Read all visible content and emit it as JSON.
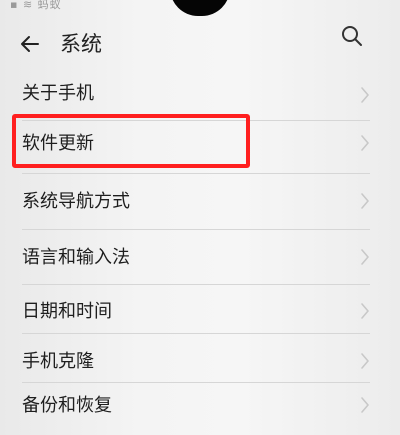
{
  "status_bar": {
    "icons_text": "▪ ≋ 蚂蚁"
  },
  "header": {
    "title": "系统",
    "back_icon": "arrow-left",
    "search_icon": "magnifier"
  },
  "menu": {
    "items": [
      {
        "label": "关于手机"
      },
      {
        "label": "软件更新"
      },
      {
        "label": "系统导航方式"
      },
      {
        "label": "语言和输入法"
      },
      {
        "label": "日期和时间"
      },
      {
        "label": "手机克隆"
      },
      {
        "label": "备份和恢复"
      }
    ]
  },
  "colors": {
    "highlight": "#ff1f1f",
    "text": "#1e1e1e",
    "chevron": "#c8c8c8"
  }
}
